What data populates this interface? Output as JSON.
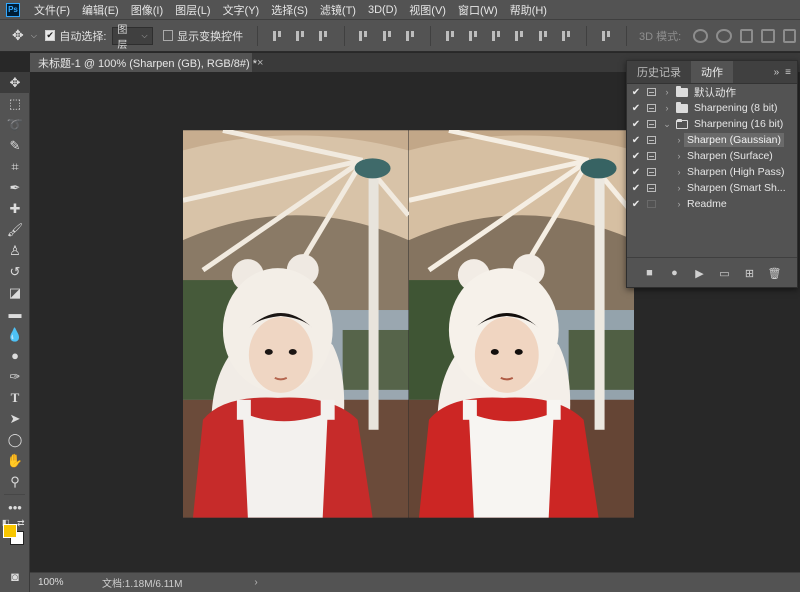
{
  "app": {
    "logo_text": "Ps"
  },
  "menu": [
    "文件(F)",
    "编辑(E)",
    "图像(I)",
    "图层(L)",
    "文字(Y)",
    "选择(S)",
    "滤镜(T)",
    "3D(D)",
    "视图(V)",
    "窗口(W)",
    "帮助(H)"
  ],
  "options_bar": {
    "auto_select_label": "自动选择:",
    "auto_select_checked": true,
    "auto_select_value": "图层",
    "show_transform_label": "显示变换控件",
    "show_transform_checked": false,
    "mode_3d_label": "3D 模式:"
  },
  "document": {
    "tab_title": "未标题-1 @ 100% (Sharpen (GB), RGB/8#) *",
    "close_glyph": "×"
  },
  "status_bar": {
    "zoom": "100%",
    "doc_info": "文档:1.18M/6.11M",
    "arrow": "›"
  },
  "colors": {
    "foreground": "#f8c600",
    "background": "#ffffff",
    "ui_panel": "#535353",
    "canvas_bg": "#282828"
  },
  "panel": {
    "tabs": [
      "历史记录",
      "动作"
    ],
    "active_tab": "动作",
    "menu_glyph": "»",
    "hamburger_glyph": "≡",
    "actions": [
      {
        "label": "默认动作",
        "type": "set",
        "expanded": false,
        "checked": true,
        "dialog": true
      },
      {
        "label": "Sharpening (8 bit)",
        "type": "set",
        "expanded": false,
        "checked": true,
        "dialog": true
      },
      {
        "label": "Sharpening (16 bit)",
        "type": "set",
        "expanded": true,
        "checked": true,
        "dialog": true
      },
      {
        "label": "Sharpen (Gaussian)",
        "type": "action",
        "selected": true,
        "checked": true,
        "dialog": true
      },
      {
        "label": "Sharpen (Surface)",
        "type": "action",
        "selected": false,
        "checked": true,
        "dialog": true
      },
      {
        "label": "Sharpen (High Pass)",
        "type": "action",
        "selected": false,
        "checked": true,
        "dialog": true
      },
      {
        "label": "Sharpen (Smart Sh...",
        "type": "action",
        "selected": false,
        "checked": true,
        "dialog": true
      },
      {
        "label": "Readme",
        "type": "action",
        "selected": false,
        "checked": true,
        "dialog": false
      }
    ],
    "bottom_icons": [
      "stop-icon",
      "record-icon",
      "play-icon",
      "new-set-icon",
      "new-action-icon",
      "delete-icon"
    ]
  }
}
